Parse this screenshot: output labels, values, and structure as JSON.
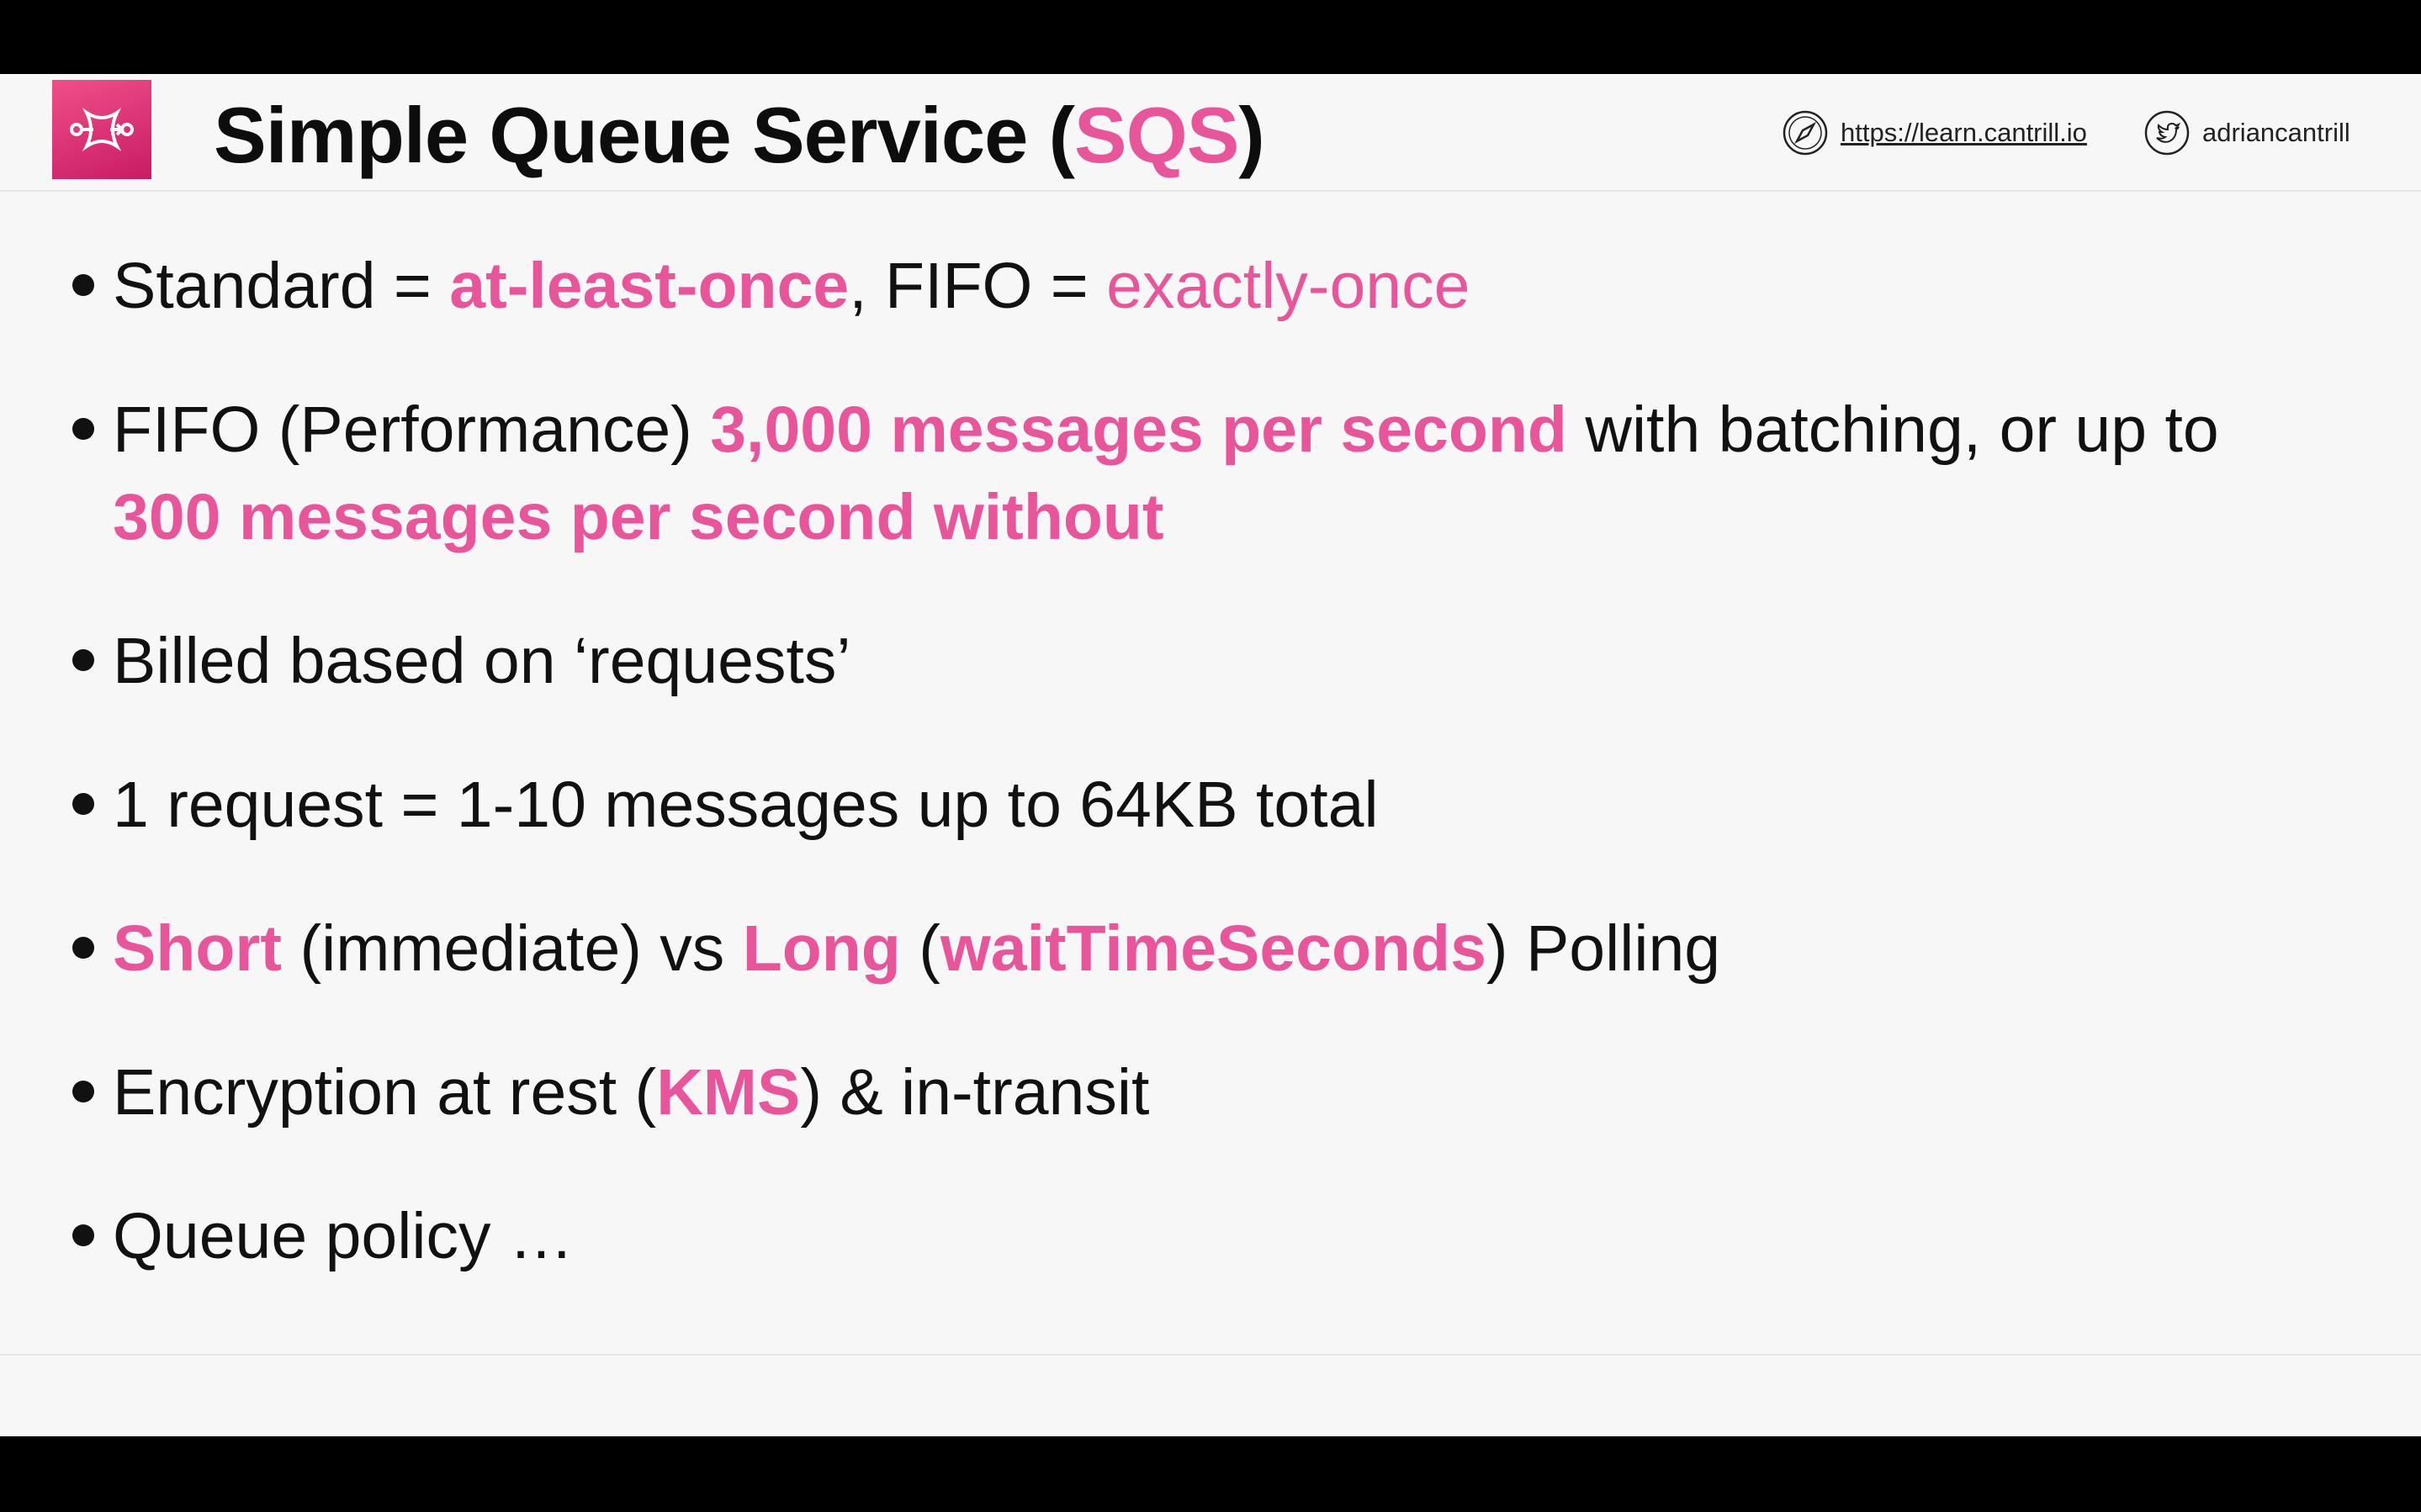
{
  "header": {
    "title_prefix": "Simple Queue Service (",
    "title_accent": "SQS",
    "title_suffix": ")",
    "logo_icon": "sqs-service-icon",
    "website_icon": "compass-icon",
    "website": "https://learn.cantrill.io",
    "twitter_icon": "twitter-bird-icon",
    "twitter": "adriancantrill"
  },
  "colors": {
    "accent": "#e8559b",
    "background": "#f7f7f7",
    "letterbox": "#000000",
    "text": "#111111"
  },
  "bullets": [
    {
      "parts": [
        "Standard = ",
        "at-least-once",
        ", FIFO = ",
        "exactly-once"
      ]
    },
    {
      "parts": [
        "FIFO (Performance) ",
        "3,000 messages per second",
        " with batching, or up to",
        "300 messages per second without"
      ]
    },
    {
      "parts": [
        "Billed based on ‘requests’"
      ]
    },
    {
      "parts": [
        "1 request = 1-10 messages up to 64KB total"
      ]
    },
    {
      "parts": [
        "Short",
        " (immediate) vs ",
        "Long",
        " (",
        "waitTimeSeconds",
        ") Polling"
      ]
    },
    {
      "parts": [
        "Encryption at rest (",
        "KMS",
        ") & in-transit"
      ]
    },
    {
      "parts": [
        "Queue policy …"
      ]
    }
  ]
}
